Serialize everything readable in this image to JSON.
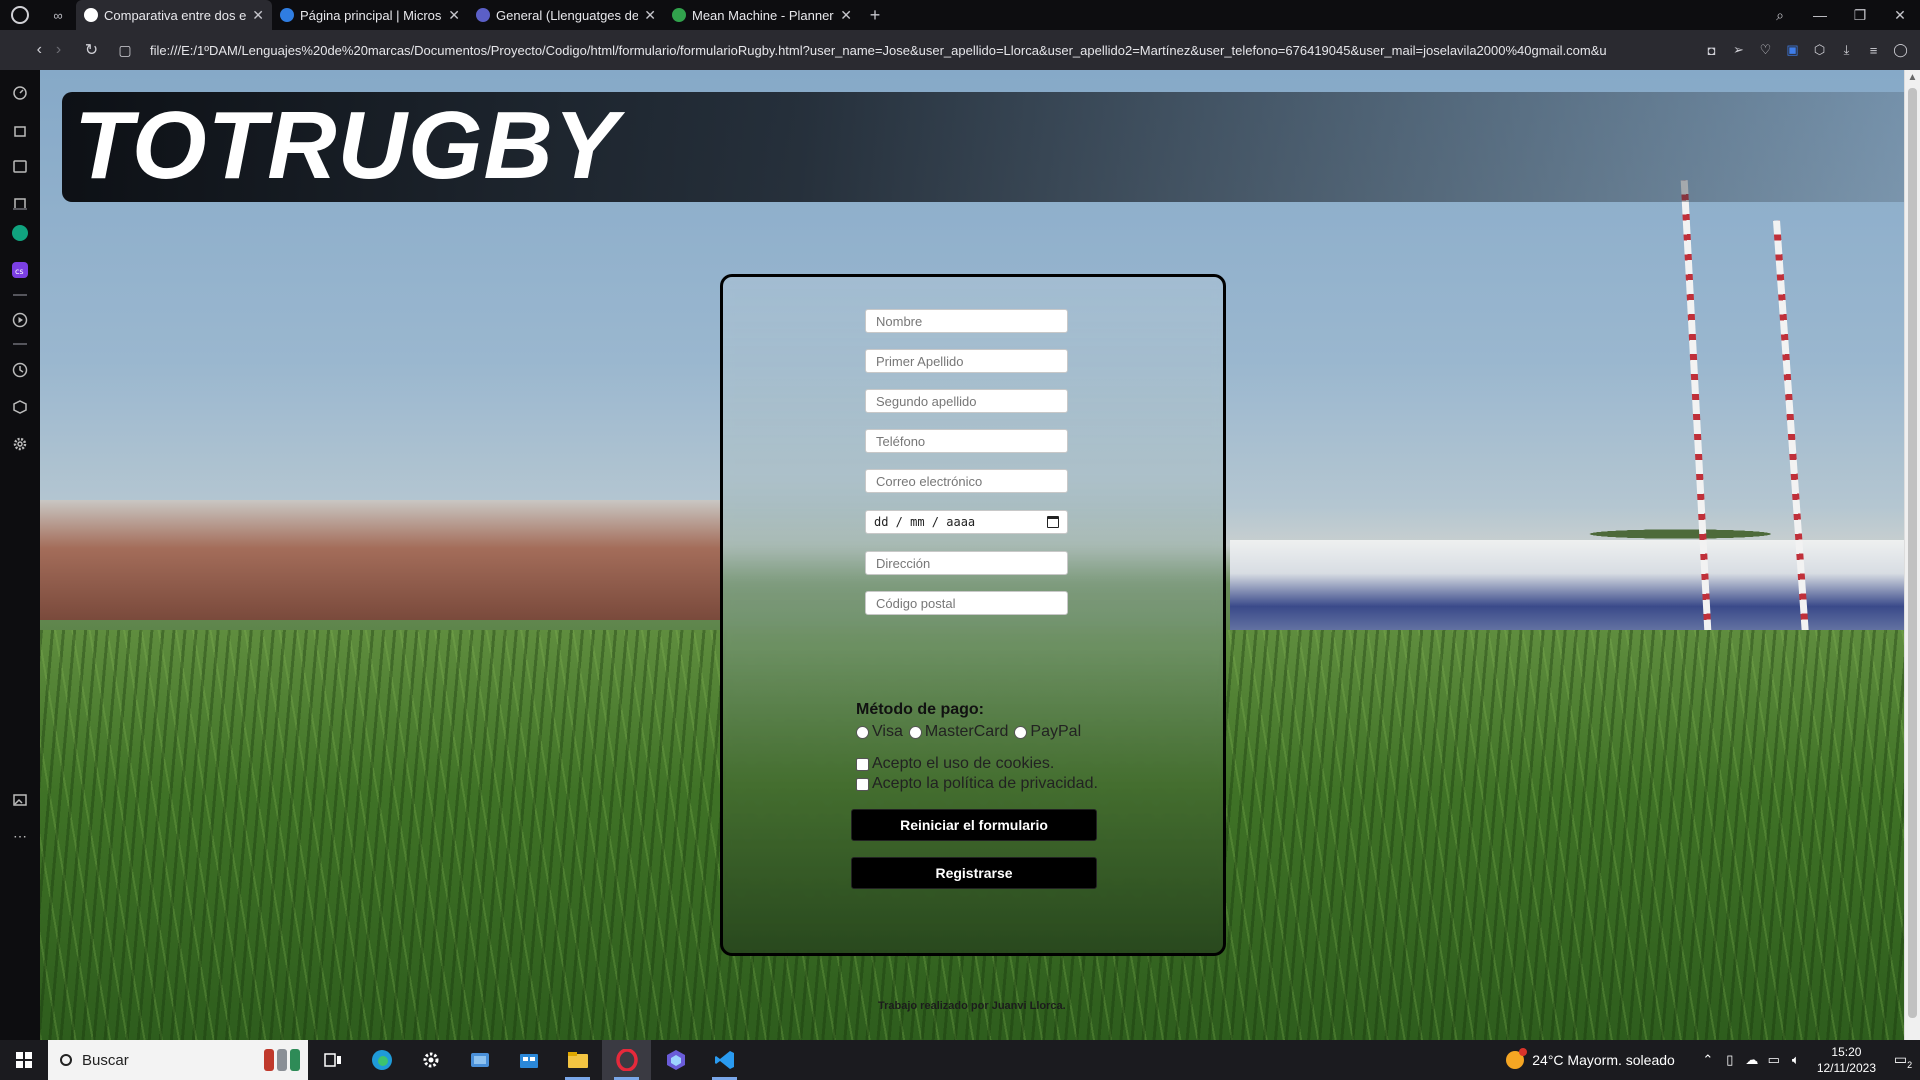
{
  "browser": {
    "tabs": [
      {
        "title": "Comparativa entre dos eq",
        "active": true,
        "favicon_color": "#ffffff"
      },
      {
        "title": "Página principal | Microsoft",
        "active": false,
        "favicon_color": "#2f7de1"
      },
      {
        "title": "General (Llenguatges de m",
        "active": false,
        "favicon_color": "#5b5fc7"
      },
      {
        "title": "Mean Machine - Planner",
        "active": false,
        "favicon_color": "#31a24c"
      }
    ],
    "url": "file:///E:/1ºDAM/Lenguajes%20de%20marcas/Documentos/Proyecto/Codigo/html/formulario/formularioRugby.html?user_name=Jose&user_apellido=Llorca&user_apellido2=Martínez&user_telefono=676419045&user_mail=joselavila2000%40gmail.com&u",
    "tool_icons": [
      "camera-icon",
      "send-icon",
      "heart-icon",
      "translate-icon",
      "cube-icon",
      "download-icon",
      "menu-icon",
      "profile-icon"
    ]
  },
  "page": {
    "logo": "TOTRUGBY",
    "form": {
      "fields": [
        {
          "name": "nombre",
          "placeholder": "Nombre"
        },
        {
          "name": "primer-apellido",
          "placeholder": "Primer Apellido"
        },
        {
          "name": "segundo-apellido",
          "placeholder": "Segundo apellido"
        },
        {
          "name": "telefono",
          "placeholder": "Teléfono"
        },
        {
          "name": "correo",
          "placeholder": "Correo electrónico"
        }
      ],
      "date_placeholder": "dd / mm / aaaa",
      "fields2": [
        {
          "name": "direccion",
          "placeholder": "Dirección"
        },
        {
          "name": "codigo-postal",
          "placeholder": "Código postal"
        }
      ],
      "payment_title": "Método de pago:",
      "payment_options": [
        "Visa",
        "MasterCard",
        "PayPal"
      ],
      "checkboxes": [
        "Acepto el uso de cookies.",
        "Acepto la política de privacidad."
      ],
      "reset_label": "Reiniciar el formulario",
      "submit_label": "Registrarse"
    },
    "credit": "Trabajo realizado por Juanvi Llorca."
  },
  "taskbar": {
    "search_placeholder": "Buscar",
    "weather": "24°C  Mayorm. soleado",
    "time": "15:20",
    "date": "12/11/2023",
    "notifications": "2"
  }
}
